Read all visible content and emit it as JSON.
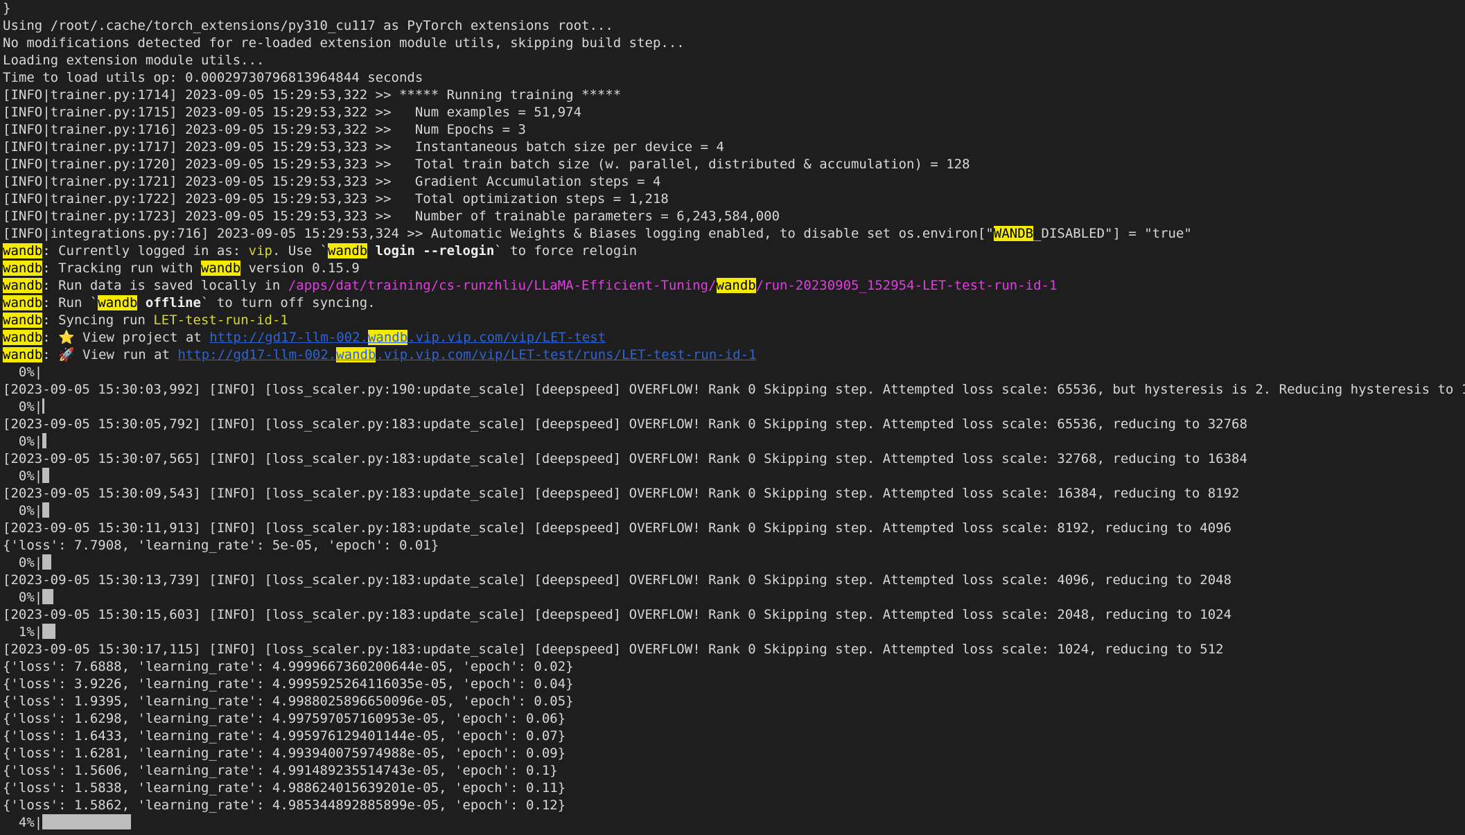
{
  "terminal": {
    "colors": {
      "background": "#1e1e1e",
      "text": "#d8d8d8",
      "highlight": "#f5eb00",
      "magenta_path": "#e23ce2",
      "link": "#2d64d8",
      "run_name": "#d7d735",
      "progress_bar": "#bdbdbd"
    },
    "lines": [
      {
        "kind": "text",
        "segments": [
          {
            "t": "}"
          }
        ]
      },
      {
        "kind": "text",
        "segments": [
          {
            "t": "Using /root/.cache/torch_extensions/py310_cu117 as PyTorch extensions root..."
          }
        ]
      },
      {
        "kind": "text",
        "segments": [
          {
            "t": "No modifications detected for re-loaded extension module utils, skipping build step..."
          }
        ]
      },
      {
        "kind": "text",
        "segments": [
          {
            "t": "Loading extension module utils..."
          }
        ]
      },
      {
        "kind": "text",
        "segments": [
          {
            "t": "Time to load utils op: 0.00029730796813964844 seconds"
          }
        ]
      },
      {
        "kind": "text",
        "segments": [
          {
            "t": "[INFO|trainer.py:1714] 2023-09-05 15:29:53,322 >> ***** Running training *****"
          }
        ]
      },
      {
        "kind": "text",
        "segments": [
          {
            "t": "[INFO|trainer.py:1715] 2023-09-05 15:29:53,322 >>   Num examples = 51,974"
          }
        ]
      },
      {
        "kind": "text",
        "segments": [
          {
            "t": "[INFO|trainer.py:1716] 2023-09-05 15:29:53,322 >>   Num Epochs = 3"
          }
        ]
      },
      {
        "kind": "text",
        "segments": [
          {
            "t": "[INFO|trainer.py:1717] 2023-09-05 15:29:53,323 >>   Instantaneous batch size per device = 4"
          }
        ]
      },
      {
        "kind": "text",
        "segments": [
          {
            "t": "[INFO|trainer.py:1720] 2023-09-05 15:29:53,323 >>   Total train batch size (w. parallel, distributed & accumulation) = 128"
          }
        ]
      },
      {
        "kind": "text",
        "segments": [
          {
            "t": "[INFO|trainer.py:1721] 2023-09-05 15:29:53,323 >>   Gradient Accumulation steps = 4"
          }
        ]
      },
      {
        "kind": "text",
        "segments": [
          {
            "t": "[INFO|trainer.py:1722] 2023-09-05 15:29:53,323 >>   Total optimization steps = 1,218"
          }
        ]
      },
      {
        "kind": "text",
        "segments": [
          {
            "t": "[INFO|trainer.py:1723] 2023-09-05 15:29:53,323 >>   Number of trainable parameters = 6,243,584,000"
          }
        ]
      },
      {
        "kind": "text",
        "segments": [
          {
            "t": "[INFO|integrations.py:716] 2023-09-05 15:29:53,324 >> Automatic Weights & Biases logging enabled, to disable set os.environ[\""
          },
          {
            "t": "WANDB",
            "s": "hl"
          },
          {
            "t": "_DISABLED\"] = \"true\""
          }
        ]
      },
      {
        "kind": "text",
        "segments": [
          {
            "t": "wandb",
            "s": "hl"
          },
          {
            "t": ": Currently logged in as: "
          },
          {
            "t": "vip",
            "s": "yellow"
          },
          {
            "t": ". Use `"
          },
          {
            "t": "wandb",
            "s": "hl"
          },
          {
            "t": " login --relogin",
            "s": "bold"
          },
          {
            "t": "` to force relogin"
          }
        ]
      },
      {
        "kind": "text",
        "segments": [
          {
            "t": "wandb",
            "s": "hl"
          },
          {
            "t": ": Tracking run with "
          },
          {
            "t": "wandb",
            "s": "hl"
          },
          {
            "t": " version 0.15.9"
          }
        ]
      },
      {
        "kind": "text",
        "segments": [
          {
            "t": "wandb",
            "s": "hl"
          },
          {
            "t": ": Run data is saved locally in "
          },
          {
            "t": "/apps/dat/training/cs-runzhliu/LLaMA-Efficient-Tuning/",
            "s": "magenta"
          },
          {
            "t": "wandb",
            "s": "hl"
          },
          {
            "t": "/run-20230905_152954-LET-test-run-id-1",
            "s": "magenta"
          }
        ]
      },
      {
        "kind": "text",
        "segments": [
          {
            "t": "wandb",
            "s": "hl"
          },
          {
            "t": ": Run `"
          },
          {
            "t": "wandb",
            "s": "hl"
          },
          {
            "t": " offline",
            "s": "bold"
          },
          {
            "t": "` to turn off syncing."
          }
        ]
      },
      {
        "kind": "text",
        "segments": [
          {
            "t": "wandb",
            "s": "hl"
          },
          {
            "t": ": Syncing run "
          },
          {
            "t": "LET-test-run-id-1",
            "s": "yellow"
          }
        ]
      },
      {
        "kind": "text",
        "segments": [
          {
            "t": "wandb",
            "s": "hl"
          },
          {
            "t": ": ⭐️ View project at "
          },
          {
            "t": "http://gd17-llm-002.",
            "s": "link"
          },
          {
            "t": "wandb",
            "s": "hl link"
          },
          {
            "t": ".vip.vip.com/vip/LET-test",
            "s": "link"
          }
        ]
      },
      {
        "kind": "text",
        "segments": [
          {
            "t": "wandb",
            "s": "hl"
          },
          {
            "t": ": 🚀 View run at "
          },
          {
            "t": "http://gd17-llm-002.",
            "s": "link"
          },
          {
            "t": "wandb",
            "s": "hl link"
          },
          {
            "t": ".vip.vip.com/vip/LET-test/runs/LET-test-run-id-1",
            "s": "link"
          }
        ]
      },
      {
        "kind": "progress",
        "label": "  0%|",
        "fraction": 0.0
      },
      {
        "kind": "text",
        "segments": [
          {
            "t": "[2023-09-05 15:30:03,992] [INFO] [loss_scaler.py:190:update_scale] [deepspeed] OVERFLOW! Rank 0 Skipping step. Attempted loss scale: 65536, but hysteresis is 2. Reducing hysteresis to 1"
          }
        ]
      },
      {
        "kind": "progress",
        "label": "  0%|",
        "fraction": 0.0,
        "cursor": true
      },
      {
        "kind": "text",
        "segments": [
          {
            "t": "[2023-09-05 15:30:05,792] [INFO] [loss_scaler.py:183:update_scale] [deepspeed] OVERFLOW! Rank 0 Skipping step. Attempted loss scale: 65536, reducing to 32768"
          }
        ]
      },
      {
        "kind": "progress",
        "label": "  0%|",
        "fraction": 0.002,
        "cursor": true
      },
      {
        "kind": "text",
        "segments": [
          {
            "t": "[2023-09-05 15:30:07,565] [INFO] [loss_scaler.py:183:update_scale] [deepspeed] OVERFLOW! Rank 0 Skipping step. Attempted loss scale: 32768, reducing to 16384"
          }
        ]
      },
      {
        "kind": "progress",
        "label": "  0%|",
        "fraction": 0.003
      },
      {
        "kind": "text",
        "segments": [
          {
            "t": "[2023-09-05 15:30:09,543] [INFO] [loss_scaler.py:183:update_scale] [deepspeed] OVERFLOW! Rank 0 Skipping step. Attempted loss scale: 16384, reducing to 8192"
          }
        ]
      },
      {
        "kind": "progress",
        "label": "  0%|",
        "fraction": 0.003
      },
      {
        "kind": "text",
        "segments": [
          {
            "t": "[2023-09-05 15:30:11,913] [INFO] [loss_scaler.py:183:update_scale] [deepspeed] OVERFLOW! Rank 0 Skipping step. Attempted loss scale: 8192, reducing to 4096"
          }
        ]
      },
      {
        "kind": "text",
        "segments": [
          {
            "t": "{'loss': 7.7908, 'learning_rate': 5e-05, 'epoch': 0.01}"
          }
        ]
      },
      {
        "kind": "progress",
        "label": "  0%|",
        "fraction": 0.004
      },
      {
        "kind": "text",
        "segments": [
          {
            "t": "[2023-09-05 15:30:13,739] [INFO] [loss_scaler.py:183:update_scale] [deepspeed] OVERFLOW! Rank 0 Skipping step. Attempted loss scale: 4096, reducing to 2048"
          }
        ]
      },
      {
        "kind": "progress",
        "label": "  0%|",
        "fraction": 0.005
      },
      {
        "kind": "text",
        "segments": [
          {
            "t": "[2023-09-05 15:30:15,603] [INFO] [loss_scaler.py:183:update_scale] [deepspeed] OVERFLOW! Rank 0 Skipping step. Attempted loss scale: 2048, reducing to 1024"
          }
        ]
      },
      {
        "kind": "progress",
        "label": "  1%|",
        "fraction": 0.006
      },
      {
        "kind": "text",
        "segments": [
          {
            "t": "[2023-09-05 15:30:17,115] [INFO] [loss_scaler.py:183:update_scale] [deepspeed] OVERFLOW! Rank 0 Skipping step. Attempted loss scale: 1024, reducing to 512"
          }
        ]
      },
      {
        "kind": "text",
        "segments": [
          {
            "t": "{'loss': 7.6888, 'learning_rate': 4.9999667360200644e-05, 'epoch': 0.02}"
          }
        ]
      },
      {
        "kind": "text",
        "segments": [
          {
            "t": "{'loss': 3.9226, 'learning_rate': 4.9995925264116035e-05, 'epoch': 0.04}"
          }
        ]
      },
      {
        "kind": "text",
        "segments": [
          {
            "t": "{'loss': 1.9395, 'learning_rate': 4.9988025896650096e-05, 'epoch': 0.05}"
          }
        ]
      },
      {
        "kind": "text",
        "segments": [
          {
            "t": "{'loss': 1.6298, 'learning_rate': 4.997597057160953e-05, 'epoch': 0.06}"
          }
        ]
      },
      {
        "kind": "text",
        "segments": [
          {
            "t": "{'loss': 1.6433, 'learning_rate': 4.995976129401144e-05, 'epoch': 0.07}"
          }
        ]
      },
      {
        "kind": "text",
        "segments": [
          {
            "t": "{'loss': 1.6281, 'learning_rate': 4.993940075974988e-05, 'epoch': 0.09}"
          }
        ]
      },
      {
        "kind": "text",
        "segments": [
          {
            "t": "{'loss': 1.5606, 'learning_rate': 4.991489235514743e-05, 'epoch': 0.1}"
          }
        ]
      },
      {
        "kind": "text",
        "segments": [
          {
            "t": "{'loss': 1.5838, 'learning_rate': 4.988624015639201e-05, 'epoch': 0.11}"
          }
        ]
      },
      {
        "kind": "text",
        "segments": [
          {
            "t": "{'loss': 1.5862, 'learning_rate': 4.985344892885899e-05, 'epoch': 0.12}"
          }
        ]
      },
      {
        "kind": "progress",
        "label": "  4%|",
        "fraction": 0.04
      }
    ]
  }
}
